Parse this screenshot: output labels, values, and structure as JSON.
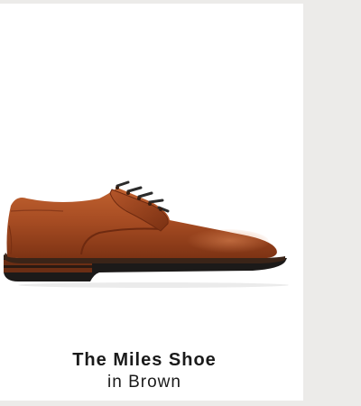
{
  "product": {
    "name": "The Miles Shoe",
    "color_line": "in Brown",
    "image_icon": "brown-derby-shoe-icon",
    "colors": {
      "leather": "#a54b22",
      "leather_dark": "#6e2a10",
      "sole": "#1c1a19",
      "welt": "#8a3a1a",
      "page_background": "#ecebe9",
      "card_background": "#ffffff",
      "text": "#1a1a1a"
    }
  }
}
